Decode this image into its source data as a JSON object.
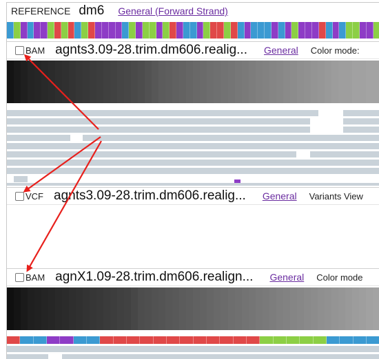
{
  "reference": {
    "label": "REFERENCE",
    "genome": "dm6",
    "link": "General (Forward Strand)"
  },
  "tracks": [
    {
      "type": "BAM",
      "title": "agnts3.09-28.trim.dm606.realig...",
      "link": "General",
      "mode_label": "Color mode:"
    },
    {
      "type": "VCF",
      "title": "agnts3.09-28.trim.dm606.realig...",
      "link": "General",
      "mode_label": "Variants View"
    },
    {
      "type": "BAM",
      "title": "agnX1.09-28.trim.dm606.realign...",
      "link": "General",
      "mode_label": "Color mode"
    }
  ],
  "colors": {
    "base_A": "#8ccf45",
    "base_C": "#3b9ad2",
    "base_G": "#8e3cc6",
    "base_T": "#e04848",
    "read": "#c9d2d9",
    "annotation_arrow": "#e8201c"
  },
  "reference_sequence": "CAGCGGATATCATGGGGCAGAAGATGCCGATTATCGCCCGCGAGGGTCGCAAGGA",
  "second_sequence": "TCCGGCCTTTTTTTTTTTTAAAAACCCC",
  "coverage_levels_top": [
    0.08,
    0.1,
    0.12,
    0.14,
    0.15,
    0.16,
    0.17,
    0.18,
    0.19,
    0.2,
    0.21,
    0.22,
    0.23,
    0.24,
    0.25,
    0.26,
    0.27,
    0.28,
    0.29,
    0.3,
    0.32,
    0.34,
    0.36,
    0.37,
    0.38,
    0.39,
    0.4,
    0.41,
    0.42,
    0.43,
    0.44,
    0.45,
    0.46,
    0.47,
    0.48,
    0.49,
    0.5,
    0.51,
    0.52,
    0.53,
    0.54,
    0.55,
    0.56,
    0.57,
    0.58,
    0.59,
    0.6,
    0.61,
    0.62,
    0.62,
    0.63,
    0.63,
    0.64,
    0.64
  ],
  "coverage_levels_bottom": [
    0.06,
    0.08,
    0.1,
    0.12,
    0.13,
    0.14,
    0.15,
    0.16,
    0.17,
    0.18,
    0.19,
    0.2,
    0.21,
    0.22,
    0.23,
    0.24,
    0.25,
    0.26,
    0.28,
    0.3,
    0.31,
    0.32,
    0.33,
    0.34,
    0.35,
    0.36,
    0.37,
    0.38,
    0.39,
    0.4,
    0.41,
    0.42,
    0.43,
    0.44,
    0.45,
    0.46,
    0.47,
    0.48,
    0.49,
    0.5,
    0.51,
    0.52,
    0.53,
    0.54,
    0.55,
    0.56,
    0.57,
    0.58,
    0.59,
    0.6,
    0.61,
    0.62,
    0.63,
    0.64
  ]
}
